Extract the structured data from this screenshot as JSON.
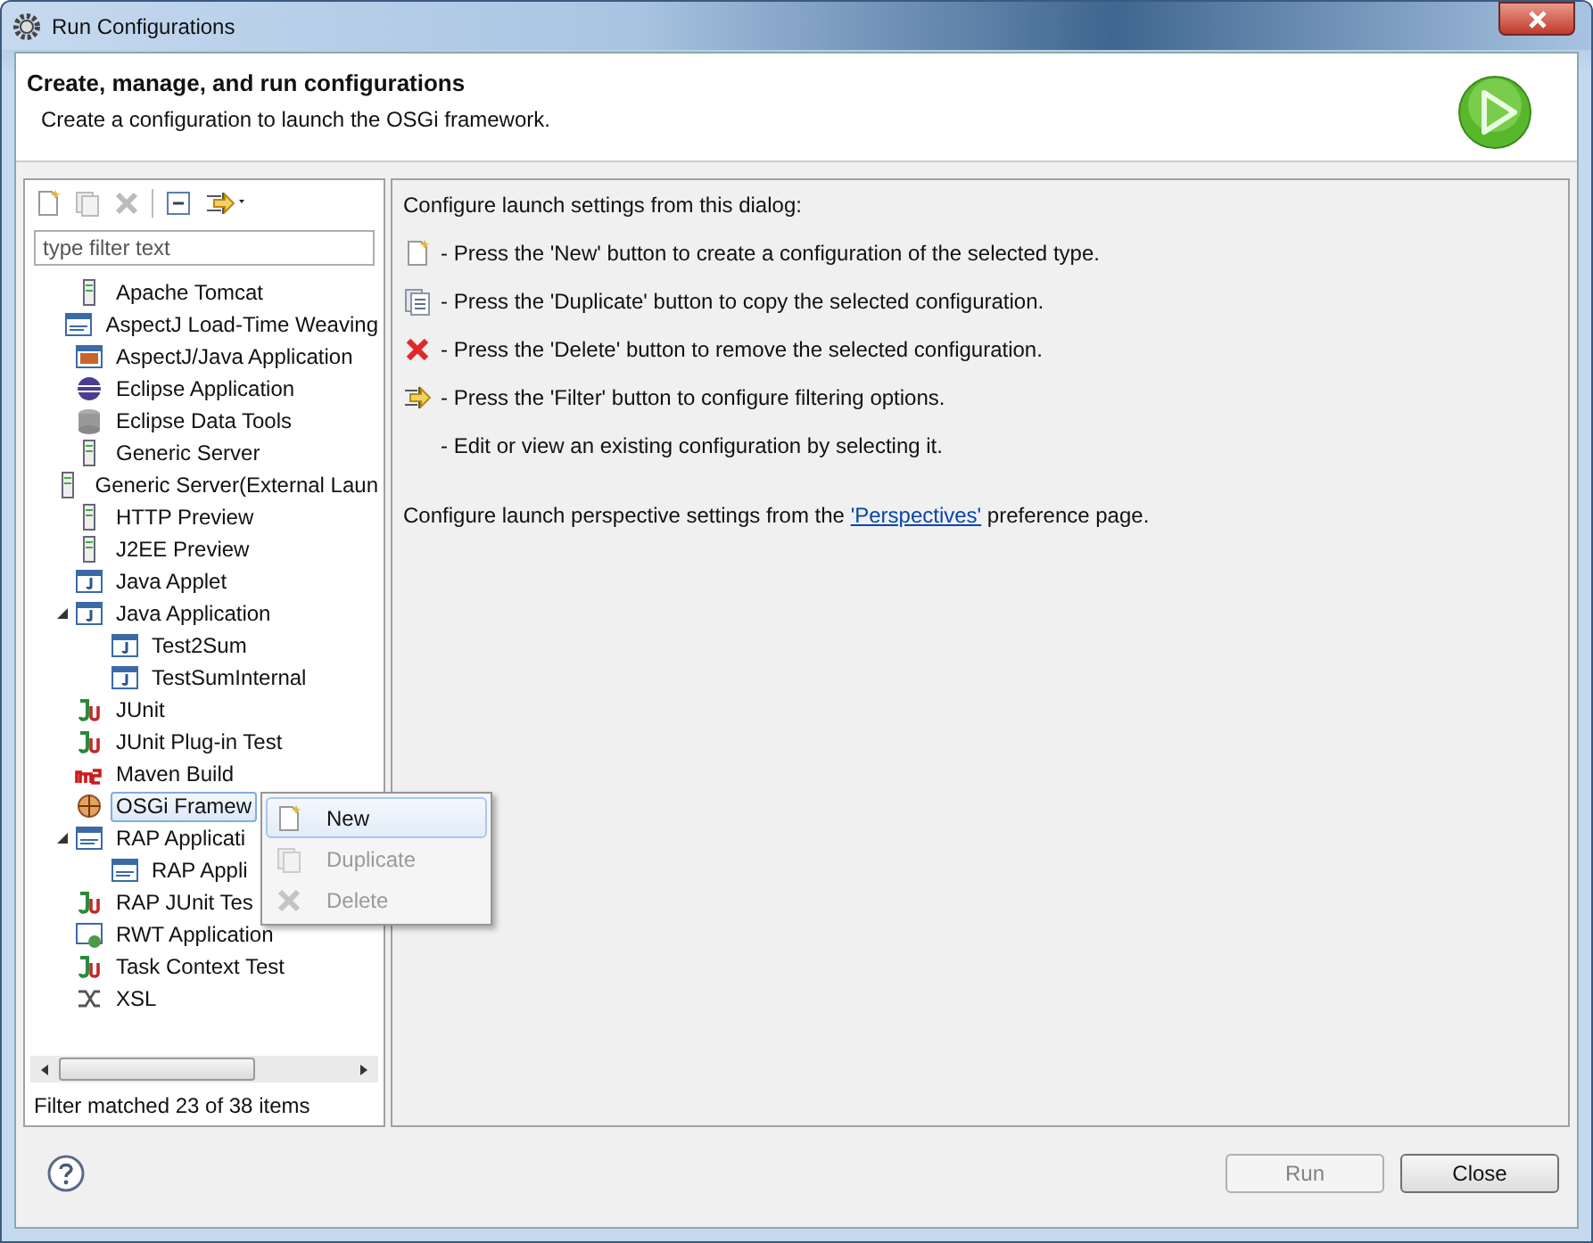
{
  "window": {
    "title": "Run Configurations"
  },
  "header": {
    "title": "Create, manage, and run configurations",
    "subtitle": "Create a configuration to launch the OSGi framework."
  },
  "filter": {
    "placeholder": "type filter text"
  },
  "tree": [
    {
      "label": "Apache Tomcat",
      "kind": "server",
      "selected": false
    },
    {
      "label": "AspectJ Load-Time Weaving",
      "kind": "ltw",
      "selected": false
    },
    {
      "label": "AspectJ/Java Application",
      "kind": "aj",
      "selected": false
    },
    {
      "label": "Eclipse Application",
      "kind": "eclipse",
      "selected": false
    },
    {
      "label": "Eclipse Data Tools",
      "kind": "db",
      "selected": false
    },
    {
      "label": "Generic Server",
      "kind": "server",
      "selected": false
    },
    {
      "label": "Generic Server(External Laun",
      "kind": "server",
      "selected": false
    },
    {
      "label": "HTTP Preview",
      "kind": "server",
      "selected": false
    },
    {
      "label": "J2EE Preview",
      "kind": "server",
      "selected": false
    },
    {
      "label": "Java Applet",
      "kind": "applet",
      "selected": false
    },
    {
      "label": "Java Application",
      "kind": "java",
      "selected": false,
      "expanded": true,
      "children": [
        {
          "label": "Test2Sum",
          "kind": "java",
          "selected": false
        },
        {
          "label": "TestSumInternal",
          "kind": "java",
          "selected": false
        }
      ]
    },
    {
      "label": "JUnit",
      "kind": "junit",
      "selected": false
    },
    {
      "label": "JUnit Plug-in Test",
      "kind": "junit",
      "selected": false
    },
    {
      "label": "Maven Build",
      "kind": "m2",
      "selected": false
    },
    {
      "label": "OSGi Framew",
      "kind": "osgi",
      "selected": true
    },
    {
      "label": "RAP Applicati",
      "kind": "rap",
      "selected": false,
      "expanded": true,
      "children": [
        {
          "label": "RAP Appli",
          "kind": "rap",
          "selected": false
        }
      ]
    },
    {
      "label": "RAP JUnit Tes",
      "kind": "junit",
      "selected": false
    },
    {
      "label": "RWT Application",
      "kind": "rwt",
      "selected": false
    },
    {
      "label": "Task Context Test",
      "kind": "junit",
      "selected": false
    },
    {
      "label": "XSL",
      "kind": "xsl",
      "selected": false
    }
  ],
  "filter_status": "Filter matched 23 of 38 items",
  "context_menu": [
    {
      "label": "New",
      "kind": "new",
      "disabled": false,
      "selected": true
    },
    {
      "label": "Duplicate",
      "kind": "duplicate",
      "disabled": true,
      "selected": false
    },
    {
      "label": "Delete",
      "kind": "delete",
      "disabled": true,
      "selected": false
    }
  ],
  "help": {
    "intro": "Configure launch settings from this dialog:",
    "lines": [
      {
        "kind": "new",
        "text": "- Press the 'New' button to create a configuration of the selected type."
      },
      {
        "kind": "duplicate",
        "text": "- Press the 'Duplicate' button to copy the selected configuration."
      },
      {
        "kind": "delete",
        "text": "- Press the 'Delete' button to remove the selected configuration."
      },
      {
        "kind": "filter",
        "text": "- Press the 'Filter' button to configure filtering options."
      },
      {
        "kind": "plain",
        "text": "- Edit or view an existing configuration by selecting it."
      }
    ],
    "perspective_before": "Configure launch perspective settings from the",
    "perspective_link": "'Perspectives'",
    "perspective_after": "preference page."
  },
  "buttons": [
    {
      "label": "Run",
      "disabled": true
    },
    {
      "label": "Close",
      "disabled": false
    }
  ]
}
